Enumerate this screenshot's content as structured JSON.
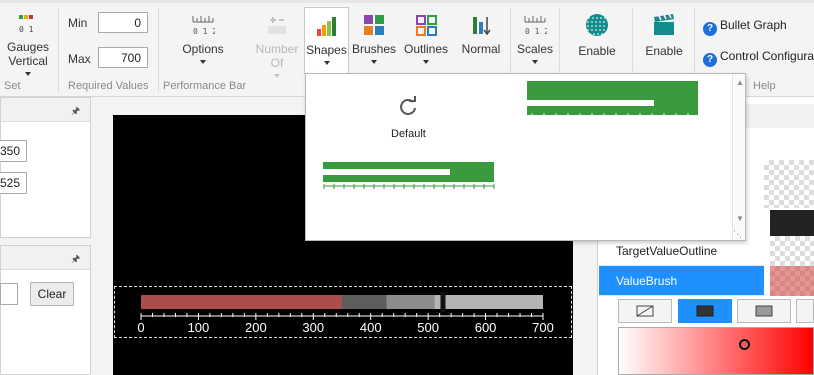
{
  "ribbon": {
    "gauges": {
      "label": "Gauges",
      "sub": "Vertical",
      "group": "Set"
    },
    "required": {
      "min_label": "Min",
      "min_value": "0",
      "max_label": "Max",
      "max_value": "700",
      "group": "Required Values"
    },
    "options": {
      "label": "Options"
    },
    "number_of": {
      "label": "Number",
      "sub": "Of"
    },
    "performance_group": "Performance Bar",
    "shapes": {
      "label": "Shapes"
    },
    "brushes": {
      "label": "Brushes"
    },
    "outlines": {
      "label": "Outlines"
    },
    "normal": {
      "label": "Normal"
    },
    "scales": {
      "label": "Scales"
    },
    "enable1": {
      "label": "Enable"
    },
    "enable2": {
      "label": "Enable"
    },
    "help": {
      "bullet_graph": "Bullet Graph",
      "control_configurator": "Control Configurator",
      "group": "Help"
    }
  },
  "left_panel": {
    "value1": "350",
    "value2": "525",
    "clear_label": "Clear"
  },
  "gauge": {
    "ticks": [
      "0",
      "100",
      "200",
      "300",
      "400",
      "500",
      "600",
      "700"
    ],
    "value": 350,
    "target": 525,
    "range_max": 700
  },
  "properties": {
    "rows": [
      {
        "label": "TargetValueOutline",
        "selected": false
      },
      {
        "label": "ValueBrush",
        "selected": true
      }
    ]
  },
  "shapes_dropdown": {
    "default_label": "Default"
  },
  "colors": {
    "accent": "#1e90ff",
    "value_brush": "#b94a4a",
    "green": "#3a9b3e"
  }
}
